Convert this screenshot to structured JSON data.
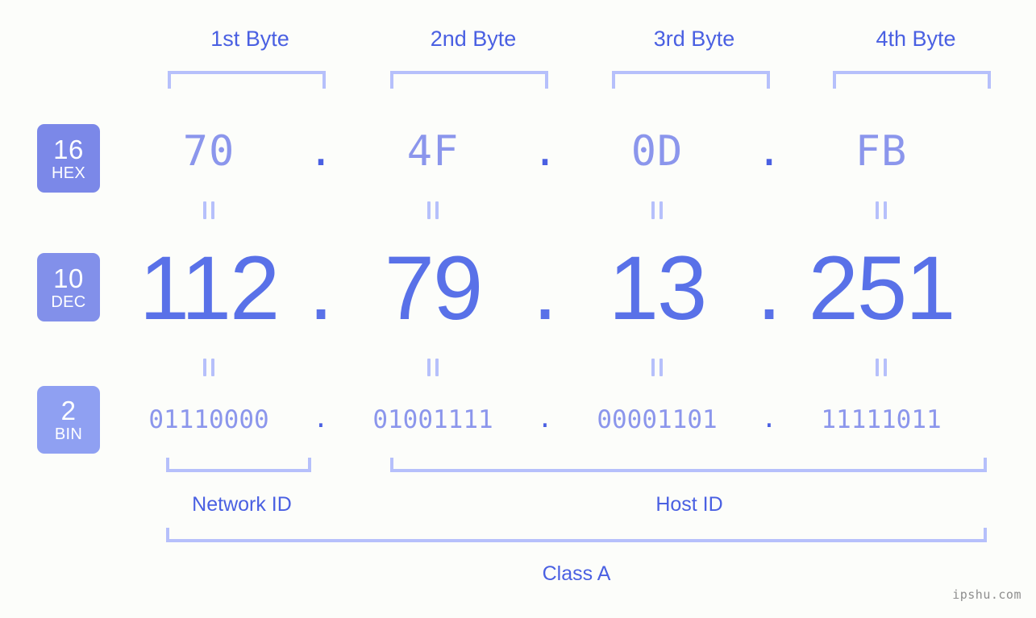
{
  "background_color": "#fcfdfa",
  "accent_strong": "#4a60e2",
  "accent_light": "#8b96ec",
  "bracket_color": "#b6c0fb",
  "header": {
    "byte_labels": [
      {
        "label": "1st Byte"
      },
      {
        "label": "2nd Byte"
      },
      {
        "label": "3rd Byte"
      },
      {
        "label": "4th Byte"
      }
    ]
  },
  "bases": [
    {
      "id": "hex",
      "number": "16",
      "system": "HEX",
      "badge_color": "#7b88e8"
    },
    {
      "id": "dec",
      "number": "10",
      "system": "DEC",
      "badge_color": "#8290ea"
    },
    {
      "id": "bin",
      "number": "2",
      "system": "BIN",
      "badge_color": "#8fa0f2"
    }
  ],
  "separator": ".",
  "equals_symbol": "=",
  "rows": {
    "hex": {
      "octets": [
        "70",
        "4F",
        "0D",
        "FB"
      ]
    },
    "dec": {
      "octets": [
        "112",
        "79",
        "13",
        "251"
      ]
    },
    "bin": {
      "octets": [
        "01110000",
        "01001111",
        "00001101",
        "11111011"
      ]
    }
  },
  "ip_address": {
    "hex": "70.4F.0D.FB",
    "dec": "112.79.13.251",
    "bin": "01110000.01001111.00001101.11111011"
  },
  "sections": {
    "network_id": "Network ID",
    "host_id": "Host ID",
    "class": "Class A"
  },
  "watermark": "ipshu.com"
}
